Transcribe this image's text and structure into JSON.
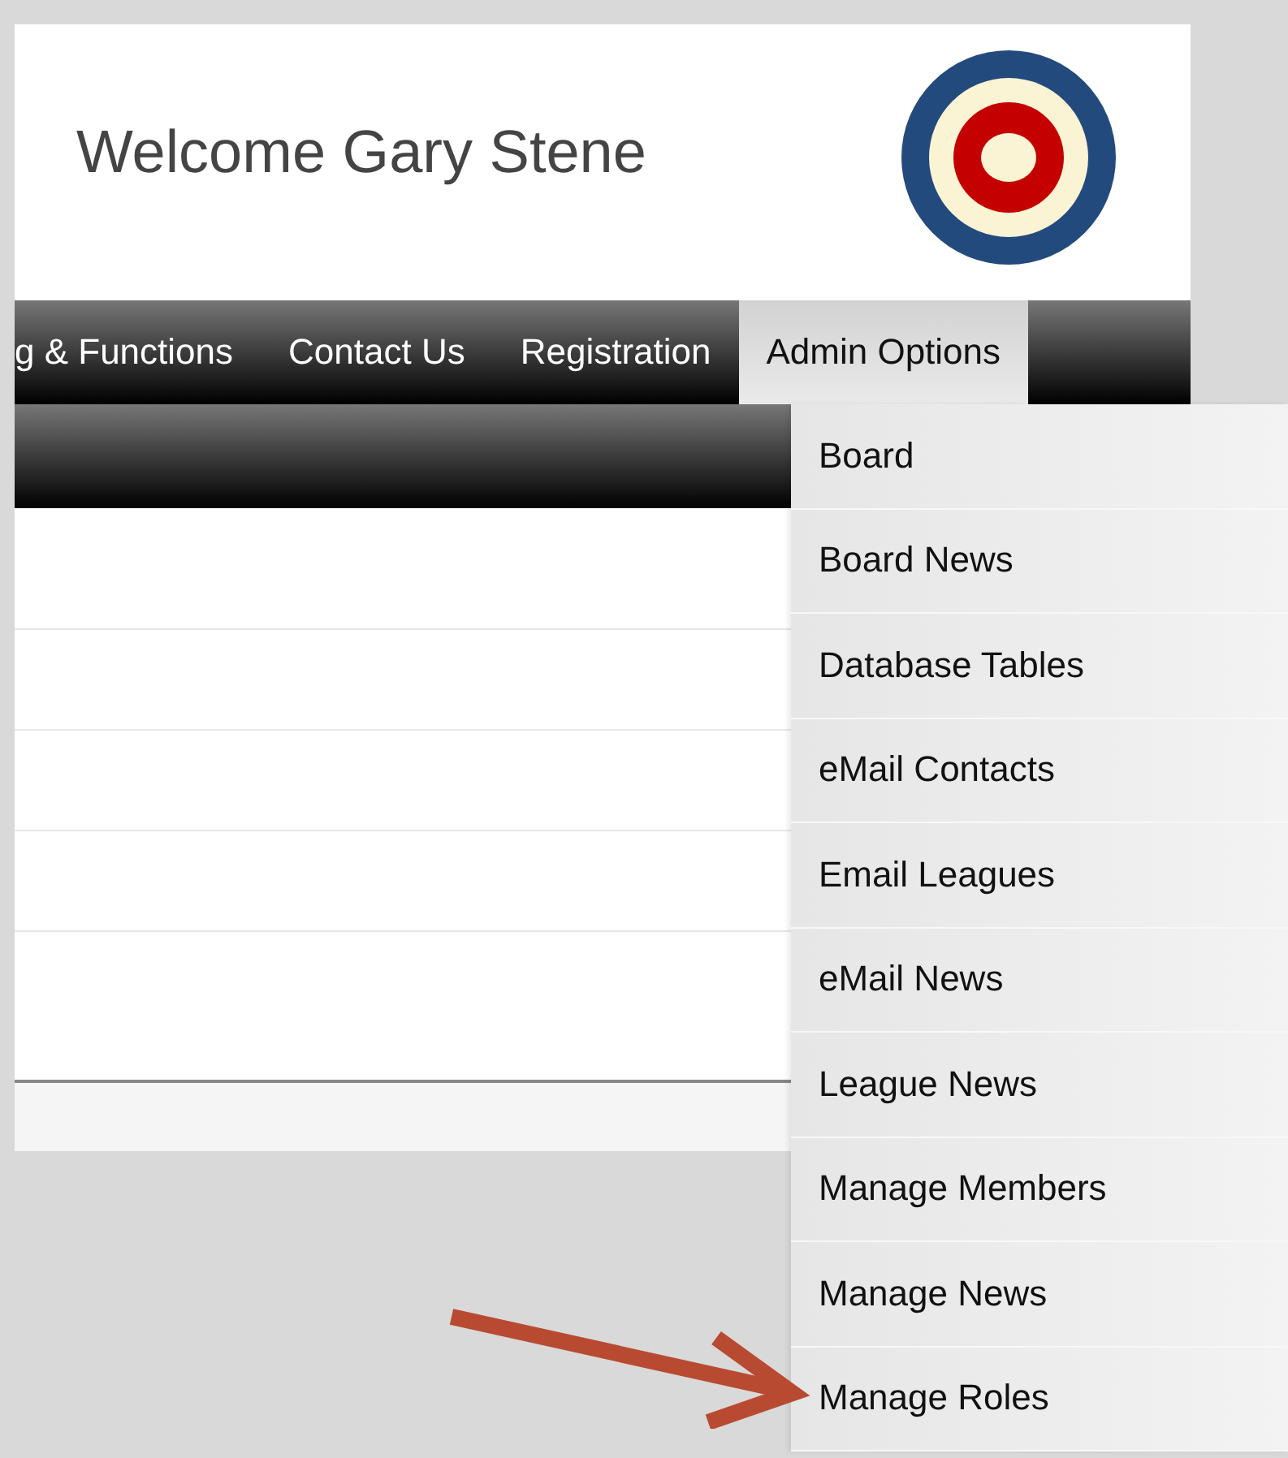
{
  "header": {
    "welcome": "Welcome Gary Stene"
  },
  "nav": [
    {
      "label": "g & Functions",
      "selected": false
    },
    {
      "label": "Contact Us",
      "selected": false
    },
    {
      "label": "Registration",
      "selected": false
    },
    {
      "label": "Admin Options",
      "selected": true
    }
  ],
  "admin_menu": [
    {
      "label": "Board"
    },
    {
      "label": "Board News"
    },
    {
      "label": "Database Tables"
    },
    {
      "label": "eMail Contacts"
    },
    {
      "label": "Email Leagues"
    },
    {
      "label": "eMail News"
    },
    {
      "label": "League News"
    },
    {
      "label": "Manage Members"
    },
    {
      "label": "Manage News"
    },
    {
      "label": "Manage Roles"
    }
  ]
}
